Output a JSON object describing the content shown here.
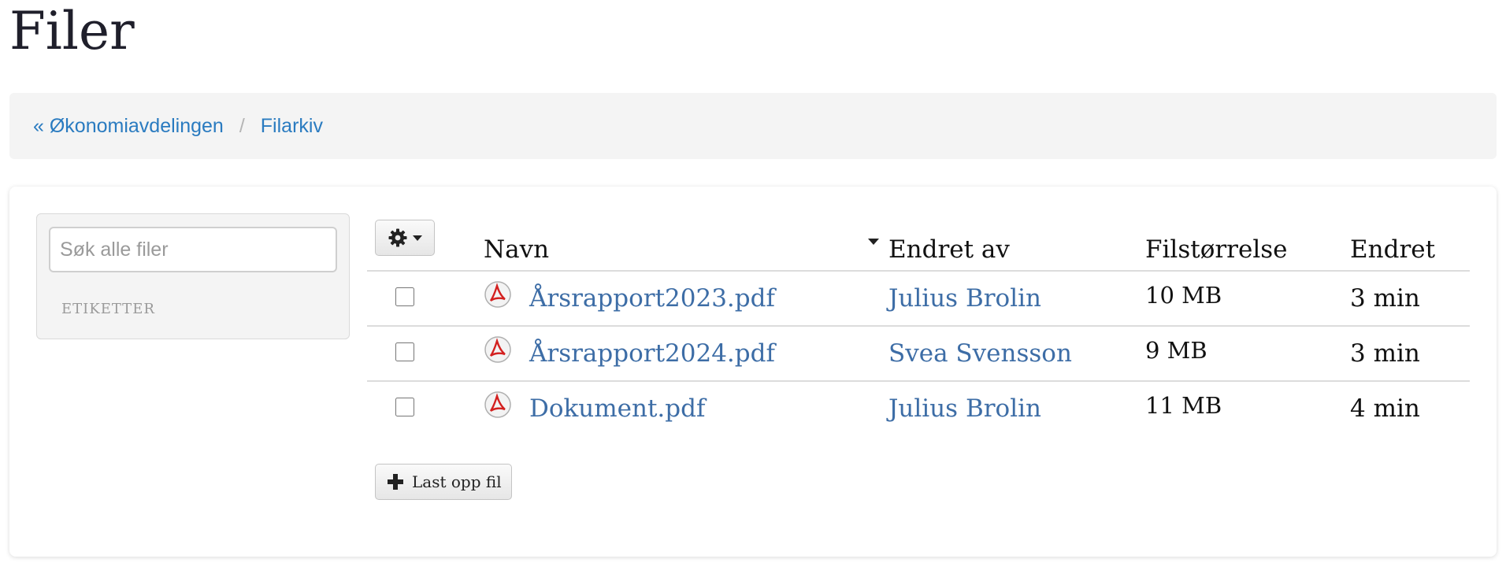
{
  "page": {
    "title": "Filer"
  },
  "breadcrumb": {
    "items": [
      {
        "label": "« Økonomiavdelingen"
      },
      {
        "label": "Filarkiv"
      }
    ],
    "separator": "/"
  },
  "sidebar": {
    "search_placeholder": "Søk alle filer",
    "tags_label": "ETIKETTER"
  },
  "toolbar": {
    "actions_icon": "gear-icon"
  },
  "table": {
    "columns": {
      "name": "Navn",
      "author": "Endret av",
      "size": "Filstørrelse",
      "changed": "Endret"
    },
    "sorted_by": "name",
    "rows": [
      {
        "name": "Årsrapport2023.pdf",
        "author": "Julius Brolin",
        "size": "10 MB",
        "changed": "3 min",
        "icon": "pdf-icon"
      },
      {
        "name": "Årsrapport2024.pdf",
        "author": "Svea Svensson",
        "size": "9 MB",
        "changed": "3 min",
        "icon": "pdf-icon"
      },
      {
        "name": "Dokument.pdf",
        "author": "Julius Brolin",
        "size": "11 MB",
        "changed": "4 min",
        "icon": "pdf-icon"
      }
    ]
  },
  "upload": {
    "label": "Last opp fil",
    "icon": "plus-icon"
  },
  "colors": {
    "link": "#3d6da6",
    "breadcrumb_link": "#2a7bc0",
    "pdf_red": "#d3201f"
  }
}
